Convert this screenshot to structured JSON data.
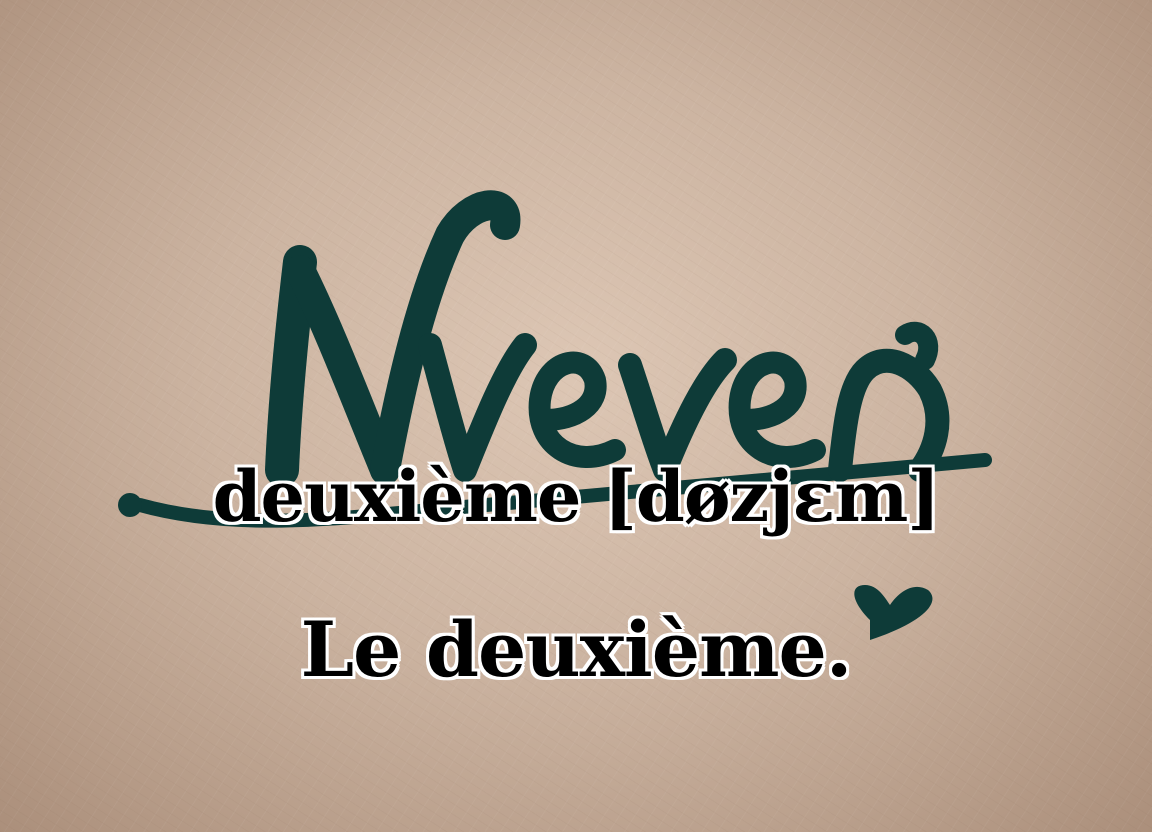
{
  "image": {
    "artwork_text": "Nvever",
    "artwork_color": "#0e3b38",
    "background_color": "#c7ac96"
  },
  "captions": {
    "word_line": "deuxième [døzjɛm]",
    "sentence_line": "Le deuxième."
  }
}
